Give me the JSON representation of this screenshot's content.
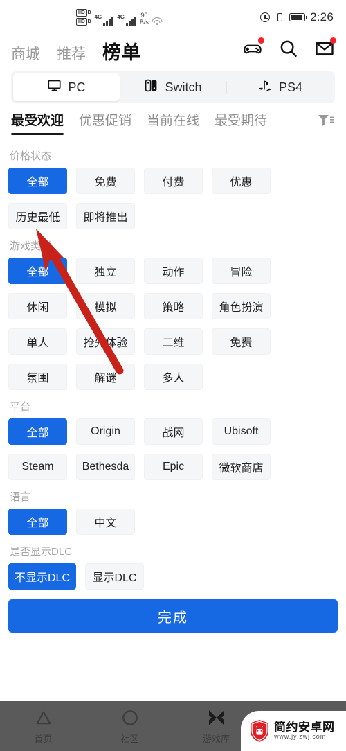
{
  "status_bar": {
    "hd_label": "HD",
    "hd_sub": "B",
    "network_label": "4G",
    "net_speed_value": "90",
    "net_speed_unit": "B/s",
    "time": "2:26",
    "icons": [
      "hd-icon",
      "signal-icon",
      "network-speed",
      "wifi-icon",
      "alarm-icon",
      "vibrate-icon",
      "battery-icon"
    ]
  },
  "header": {
    "nav": [
      {
        "label": "商城",
        "active": false
      },
      {
        "label": "推荐",
        "active": false
      },
      {
        "label": "榜单",
        "active": true
      }
    ],
    "actions": [
      {
        "name": "gamepad-icon",
        "badge": true
      },
      {
        "name": "search-icon",
        "badge": false
      },
      {
        "name": "mail-icon",
        "badge": true
      }
    ]
  },
  "platform_segment": {
    "options": [
      {
        "label": "PC",
        "icon": "monitor-icon",
        "active": true
      },
      {
        "label": "Switch",
        "icon": "switch-icon",
        "active": false
      },
      {
        "label": "PS4",
        "icon": "playstation-icon",
        "active": false
      }
    ]
  },
  "sub_tabs": {
    "items": [
      {
        "label": "最受欢迎",
        "active": true
      },
      {
        "label": "优惠促销",
        "active": false
      },
      {
        "label": "当前在线",
        "active": false
      },
      {
        "label": "最受期待",
        "active": false
      }
    ],
    "filter_icon": "filter-icon"
  },
  "filter_groups": [
    {
      "title": "价格状态",
      "chips": [
        {
          "label": "全部",
          "selected": true
        },
        {
          "label": "免费",
          "selected": false
        },
        {
          "label": "付费",
          "selected": false
        },
        {
          "label": "优惠",
          "selected": false
        },
        {
          "label": "历史最低",
          "selected": false
        },
        {
          "label": "即将推出",
          "selected": false
        }
      ]
    },
    {
      "title": "游戏类型",
      "chips": [
        {
          "label": "全部",
          "selected": true
        },
        {
          "label": "独立",
          "selected": false
        },
        {
          "label": "动作",
          "selected": false
        },
        {
          "label": "冒险",
          "selected": false
        },
        {
          "label": "休闲",
          "selected": false
        },
        {
          "label": "模拟",
          "selected": false
        },
        {
          "label": "策略",
          "selected": false
        },
        {
          "label": "角色扮演",
          "selected": false
        },
        {
          "label": "单人",
          "selected": false
        },
        {
          "label": "抢先体验",
          "selected": false
        },
        {
          "label": "二维",
          "selected": false
        },
        {
          "label": "免费",
          "selected": false
        },
        {
          "label": "氛围",
          "selected": false
        },
        {
          "label": "解谜",
          "selected": false
        },
        {
          "label": "多人",
          "selected": false
        }
      ]
    },
    {
      "title": "平台",
      "chips": [
        {
          "label": "全部",
          "selected": true
        },
        {
          "label": "Origin",
          "selected": false
        },
        {
          "label": "战网",
          "selected": false
        },
        {
          "label": "Ubisoft",
          "selected": false
        },
        {
          "label": "Steam",
          "selected": false
        },
        {
          "label": "Bethesda",
          "selected": false
        },
        {
          "label": "Epic",
          "selected": false
        },
        {
          "label": "微软商店",
          "selected": false
        }
      ]
    },
    {
      "title": "语言",
      "chips": [
        {
          "label": "全部",
          "selected": true
        },
        {
          "label": "中文",
          "selected": false
        }
      ]
    },
    {
      "title": "是否显示DLC",
      "chips": [
        {
          "label": "不显示DLC",
          "selected": true
        },
        {
          "label": "显示DLC",
          "selected": false
        }
      ]
    }
  ],
  "done_button": {
    "label": "完成"
  },
  "bottom_nav": {
    "items": [
      {
        "label": "首页",
        "icon": "triangle-icon"
      },
      {
        "label": "社区",
        "icon": "circle-icon"
      },
      {
        "label": "游戏库",
        "icon": "star-x-icon"
      },
      {
        "label": "",
        "icon": "library-icon"
      }
    ]
  },
  "watermark": {
    "title": "简约安卓网",
    "url": "www.jylzwj.com",
    "logo": "android-shield-icon"
  },
  "annotation": {
    "type": "red-arrow",
    "points_to": "历史最低"
  },
  "colors": {
    "accent_blue": "#1668e3",
    "chip_bg": "#f5f6f8",
    "badge_red": "#f5222d",
    "arrow_red": "#c8221a",
    "text_primary": "#1a1a1a",
    "text_muted": "#9a9a9a"
  }
}
